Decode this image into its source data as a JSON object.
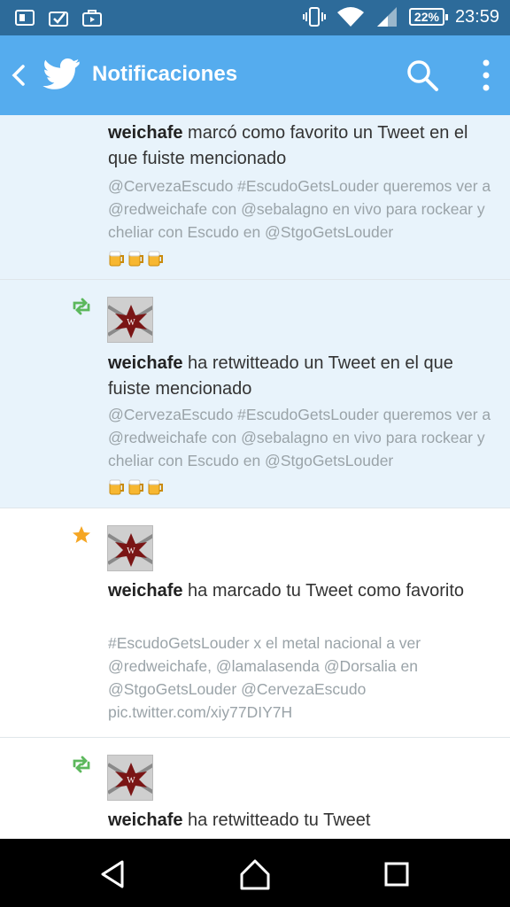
{
  "status_bar": {
    "time": "23:59",
    "battery": "22%",
    "icons": [
      "notification-icon",
      "check-icon",
      "briefcase-icon",
      "vibrate-icon",
      "wifi-icon",
      "signal-icon"
    ]
  },
  "app_bar": {
    "title": "Notificaciones",
    "icons": [
      "back-icon",
      "twitter-bird-icon",
      "search-icon",
      "more-options-icon"
    ],
    "color": "#55acee"
  },
  "notifications": [
    {
      "type": "favorite-mention",
      "user": "weichafe",
      "action": " marcó como favorito un Tweet en el que fuiste mencionado",
      "tweet": "@CervezaEscudo #EscudoGetsLouder queremos ver a @redweichafe con @sebalagno en vivo para rockear y cheliar con Escudo en @StgoGetsLouder",
      "emojis": [
        "beer-mug-icon",
        "beer-mug-icon",
        "beer-mug-icon"
      ]
    },
    {
      "type": "retweet-mention",
      "user": "weichafe",
      "action": " ha retwitteado un Tweet en el que fuiste mencionado",
      "tweet": "@CervezaEscudo #EscudoGetsLouder queremos ver a @redweichafe con @sebalagno en vivo para rockear y cheliar con Escudo en @StgoGetsLouder",
      "emojis": [
        "beer-mug-icon",
        "beer-mug-icon",
        "beer-mug-icon"
      ]
    },
    {
      "type": "favorite",
      "user": "weichafe",
      "action": " ha marcado tu Tweet como favorito",
      "tweet": "#EscudoGetsLouder x el metal nacional a ver @redweichafe,  @lamalasenda @Dorsalia en @StgoGetsLouder @CervezaEscudo pic.twitter.com/xiy77DIY7H"
    },
    {
      "type": "retweet",
      "user": "weichafe",
      "action": " ha retwitteado tu Tweet"
    }
  ],
  "nav_bar": {
    "icons": [
      "back-nav-icon",
      "home-nav-icon",
      "recents-nav-icon"
    ]
  },
  "colors": {
    "status_bar": "#2d6b9a",
    "retweet_green": "#5cb85c",
    "favorite_star": "#f5a623",
    "highlight_row": "#e8f3fb"
  }
}
